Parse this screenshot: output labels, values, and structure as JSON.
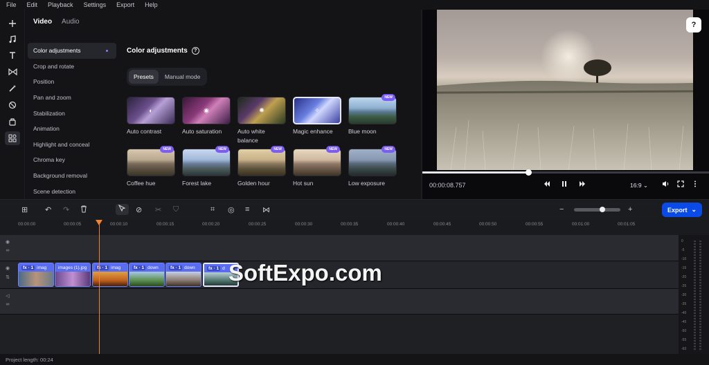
{
  "menu": [
    "File",
    "Edit",
    "Playback",
    "Settings",
    "Export",
    "Help"
  ],
  "editor": {
    "tabs": [
      "Video",
      "Audio"
    ],
    "nav": [
      "Color adjustments",
      "Crop and rotate",
      "Position",
      "Pan and zoom",
      "Stabilization",
      "Animation",
      "Highlight and conceal",
      "Chroma key",
      "Background removal",
      "Scene detection"
    ],
    "title": "Color adjustments",
    "modes": [
      "Presets",
      "Manual mode"
    ],
    "presets": [
      {
        "label": "Auto contrast",
        "new": false
      },
      {
        "label": "Auto saturation",
        "new": false
      },
      {
        "label": "Auto white balance",
        "new": false
      },
      {
        "label": "Magic enhance",
        "new": false
      },
      {
        "label": "Blue moon",
        "new": true
      },
      {
        "label": "Coffee hue",
        "new": true
      },
      {
        "label": "Forest lake",
        "new": true
      },
      {
        "label": "Golden hour",
        "new": true
      },
      {
        "label": "Hot sun",
        "new": true
      },
      {
        "label": "Low exposure",
        "new": true
      }
    ],
    "new_badge": "NEW"
  },
  "preview": {
    "time": "00:00:08.757",
    "aspect": "16:9",
    "progress": 0.37
  },
  "toolbar": {
    "export_label": "Export"
  },
  "ruler": [
    "00:00:00",
    "00:00:05",
    "00:00:10",
    "00:00:15",
    "00:00:20",
    "00:00:25",
    "00:00:30",
    "00:00:35",
    "00:00:40",
    "00:00:45",
    "00:00:50",
    "00:00:55",
    "00:01:00",
    "00:01:05"
  ],
  "clips": [
    {
      "fx": "fx · 1",
      "name": "imag"
    },
    {
      "fx": "",
      "name": "images (1).jpg"
    },
    {
      "fx": "fx · 1",
      "name": "imag"
    },
    {
      "fx": "fx · 1",
      "name": "down"
    },
    {
      "fx": "fx · 1",
      "name": "down"
    },
    {
      "fx": "fx · 1",
      "name": "d"
    }
  ],
  "meter_labels": [
    "0",
    "-5",
    "-10",
    "-15",
    "-20",
    "-25",
    "-30",
    "-35",
    "-40",
    "-45",
    "-50",
    "-55",
    "-60"
  ],
  "footer": "Project length: 00:24",
  "watermark": "SoftExpo.com",
  "colors": {
    "accent": "#0a4be8",
    "clip": "#4c5fd8",
    "playhead": "#f08230",
    "badge": "#7b5cf5"
  }
}
